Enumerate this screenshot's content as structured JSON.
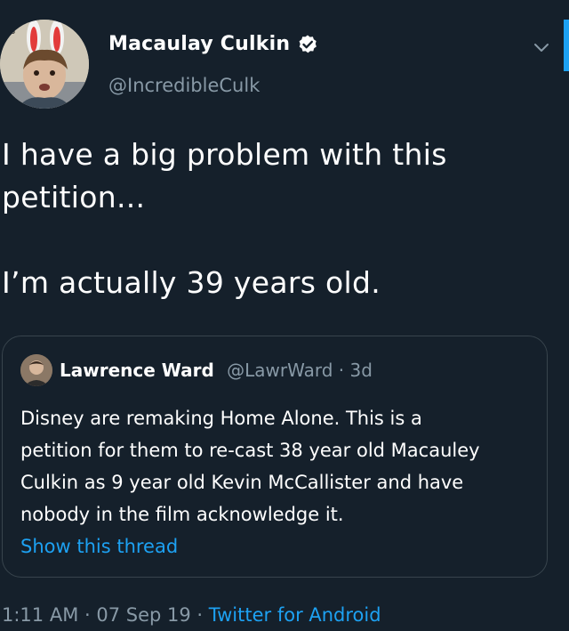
{
  "author": {
    "display_name": "Macaulay Culkin",
    "handle": "@IncredibleCulk",
    "verified": true,
    "avatar_icon": "profile-photo-bunny-ears"
  },
  "tweet": {
    "lines": [
      "I have a big problem with this",
      "petition...",
      "I’m actually 39 years old."
    ]
  },
  "quoted": {
    "name": "Lawrence Ward",
    "handle": "@LawrWard",
    "separator": " · ",
    "age": "3d",
    "lines": [
      "Disney are remaking Home Alone. This is a",
      "petition for them to re-cast 38 year old Macauley",
      "Culkin as 9 year old Kevin McCallister and have",
      "nobody in the film acknowledge it."
    ],
    "show_thread": "Show this thread"
  },
  "footer": {
    "time": "1:11 AM",
    "separator": " · ",
    "date": "07 Sep 19",
    "separator2": " · ",
    "source": "Twitter for Android"
  },
  "colors": {
    "background": "#15202b",
    "accent": "#1da1f2",
    "secondary_text": "#8899a6",
    "border": "#38444d"
  }
}
